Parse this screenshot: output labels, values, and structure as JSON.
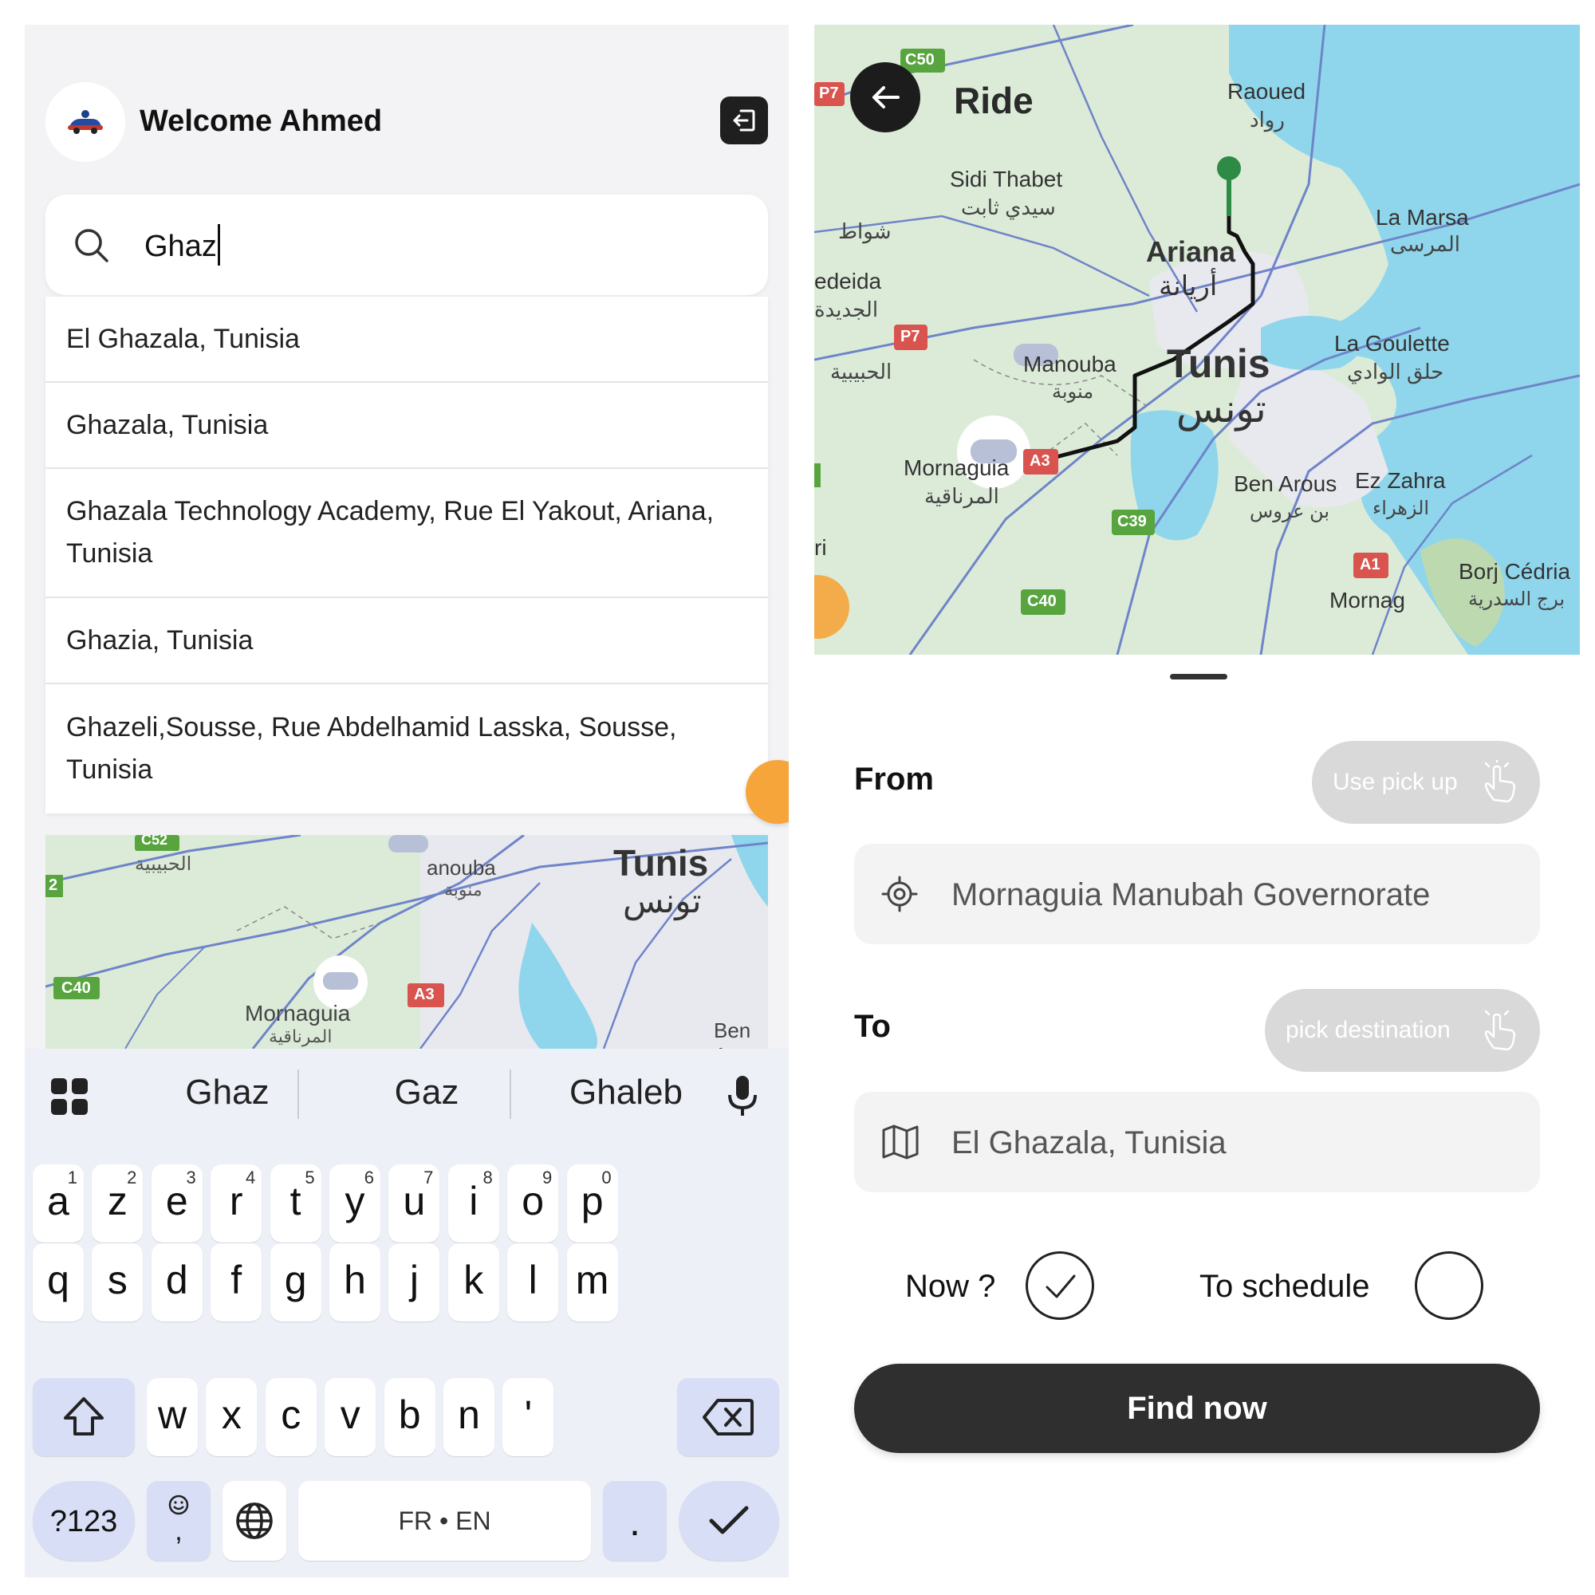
{
  "left": {
    "header": {
      "welcome": "Welcome Ahmed"
    },
    "search": {
      "value": "Ghaz"
    },
    "results": [
      "El Ghazala, Tunisia",
      "Ghazala, Tunisia",
      "Ghazala Technology Academy, Rue El Yakout, Ariana, Tunisia",
      "Ghazia, Tunisia",
      "Ghazeli,Sousse, Rue Abdelhamid Lasska, Sousse, Tunisia"
    ],
    "map_labels": {
      "road_c52": "C52",
      "road_2": "2",
      "habibia_ar": "الحبيبية",
      "manouba": "anouba",
      "manouba_ar": "منوبة",
      "tunis": "Tunis",
      "tunis_ar": "تونس",
      "road_c40": "C40",
      "road_a3": "A3",
      "mornaguia": "Mornaguia",
      "mornaguia_ar": "المرناقية",
      "ben_arous": "Ben A"
    },
    "keyboard": {
      "suggestions": [
        "Ghaz",
        "Gaz",
        "Ghaleb"
      ],
      "row1": [
        {
          "k": "a",
          "n": "1"
        },
        {
          "k": "z",
          "n": "2"
        },
        {
          "k": "e",
          "n": "3"
        },
        {
          "k": "r",
          "n": "4"
        },
        {
          "k": "t",
          "n": "5"
        },
        {
          "k": "y",
          "n": "6"
        },
        {
          "k": "u",
          "n": "7"
        },
        {
          "k": "i",
          "n": "8"
        },
        {
          "k": "o",
          "n": "9"
        },
        {
          "k": "p",
          "n": "0"
        }
      ],
      "row2": [
        "q",
        "s",
        "d",
        "f",
        "g",
        "h",
        "j",
        "k",
        "l",
        "m"
      ],
      "row3": [
        "w",
        "x",
        "c",
        "v",
        "b",
        "n",
        "'"
      ],
      "symbols": "?123",
      "emoji_comma": ",",
      "space": "FR • EN",
      "period": "."
    }
  },
  "right": {
    "title": "Ride",
    "map_labels": {
      "c50": "C50",
      "p7a": "P7",
      "p7b": "P7",
      "a3": "A3",
      "c39": "C39",
      "c40": "C40",
      "a1": "A1",
      "raoued": "Raoued",
      "raoued_ar": "رواد",
      "sidi_thabet": "Sidi Thabet",
      "sidi_thabet_ar": "سيدي ثابت",
      "chouat_ar": "شواط",
      "jedeida": "edeida",
      "jedeida_ar": "الجديدة",
      "ariana": "Ariana",
      "ariana_ar": "أريانة",
      "la_marsa": "La Marsa",
      "la_marsa_ar": "المرسى",
      "la_goulette": "La Goulette",
      "la_goulette_ar": "حلق الوادي",
      "habibia_ar": "الحبيبية",
      "manouba": "Manouba",
      "manouba_ar": "منوبة",
      "tunis": "Tunis",
      "tunis_ar": "تونس",
      "mornaguia": "Mornaguia",
      "mornaguia_ar": "المرناقية",
      "ben_arous": "Ben Arous",
      "ben_arous_ar": "بن عروس",
      "ez_zahra": "Ez Zahra",
      "ez_zahra_ar": "الزهراء",
      "borj_cedria": "Borj Cédria",
      "borj_cedria_ar": "برج السدرية",
      "mornag": "Mornag",
      "tebourba_frag": "ri"
    },
    "from_label": "From",
    "use_pickup": "Use pick up",
    "from_value": "Mornaguia Manubah Governorate",
    "to_label": "To",
    "pick_destination": "pick destination",
    "to_value": "El Ghazala, Tunisia",
    "now_label": "Now ?",
    "schedule_label": "To schedule",
    "find_button": "Find now"
  },
  "colors": {
    "map_land": "#dcebd8",
    "map_water": "#8fd6ec",
    "map_road": "#6f84c9",
    "map_urban": "#e8e9ee",
    "route": "#111111",
    "dest_pin": "#2e8b45",
    "accent_orange": "#f5a53a",
    "button_dark": "#2f2f2f",
    "pill_grey": "#d9d9d9",
    "keyboard_fn": "#d8def5"
  }
}
